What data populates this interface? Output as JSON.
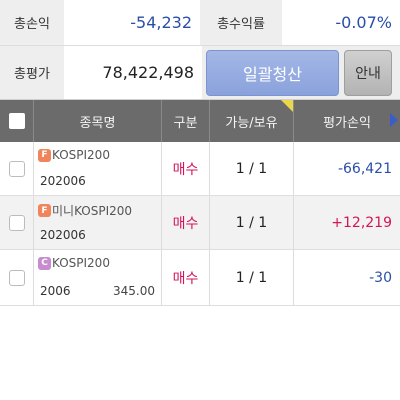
{
  "summary": {
    "total_pl_label": "총손익",
    "total_pl_value": "-54,232",
    "total_return_label": "총수익률",
    "total_return_value": "-0.07%",
    "total_eval_label": "총평가",
    "total_eval_value": "78,422,498",
    "liquidate_all_label": "일괄청산",
    "guide_label": "안내"
  },
  "table": {
    "headers": {
      "name": "종목명",
      "type": "구분",
      "qty": "가능/보유",
      "pl": "평가손익"
    },
    "rows": [
      {
        "badge": "F",
        "name": "KOSPI200",
        "code": "202006",
        "price": "",
        "type": "매수",
        "qty": "1 / 1",
        "pl": "-66,421"
      },
      {
        "badge": "F",
        "name": "미니KOSPI200",
        "code": "202006",
        "price": "",
        "type": "매수",
        "qty": "1 / 1",
        "pl": "+12,219"
      },
      {
        "badge": "C",
        "name": "KOSPI200",
        "code": "2006",
        "price": "345.00",
        "type": "매수",
        "qty": "1 / 1",
        "pl": "-30"
      }
    ]
  },
  "colors": {
    "negative": "#2a4ea8",
    "positive": "#d4145a",
    "header_bg": "#6b6b6b",
    "button_primary": "#8aa2dc"
  }
}
